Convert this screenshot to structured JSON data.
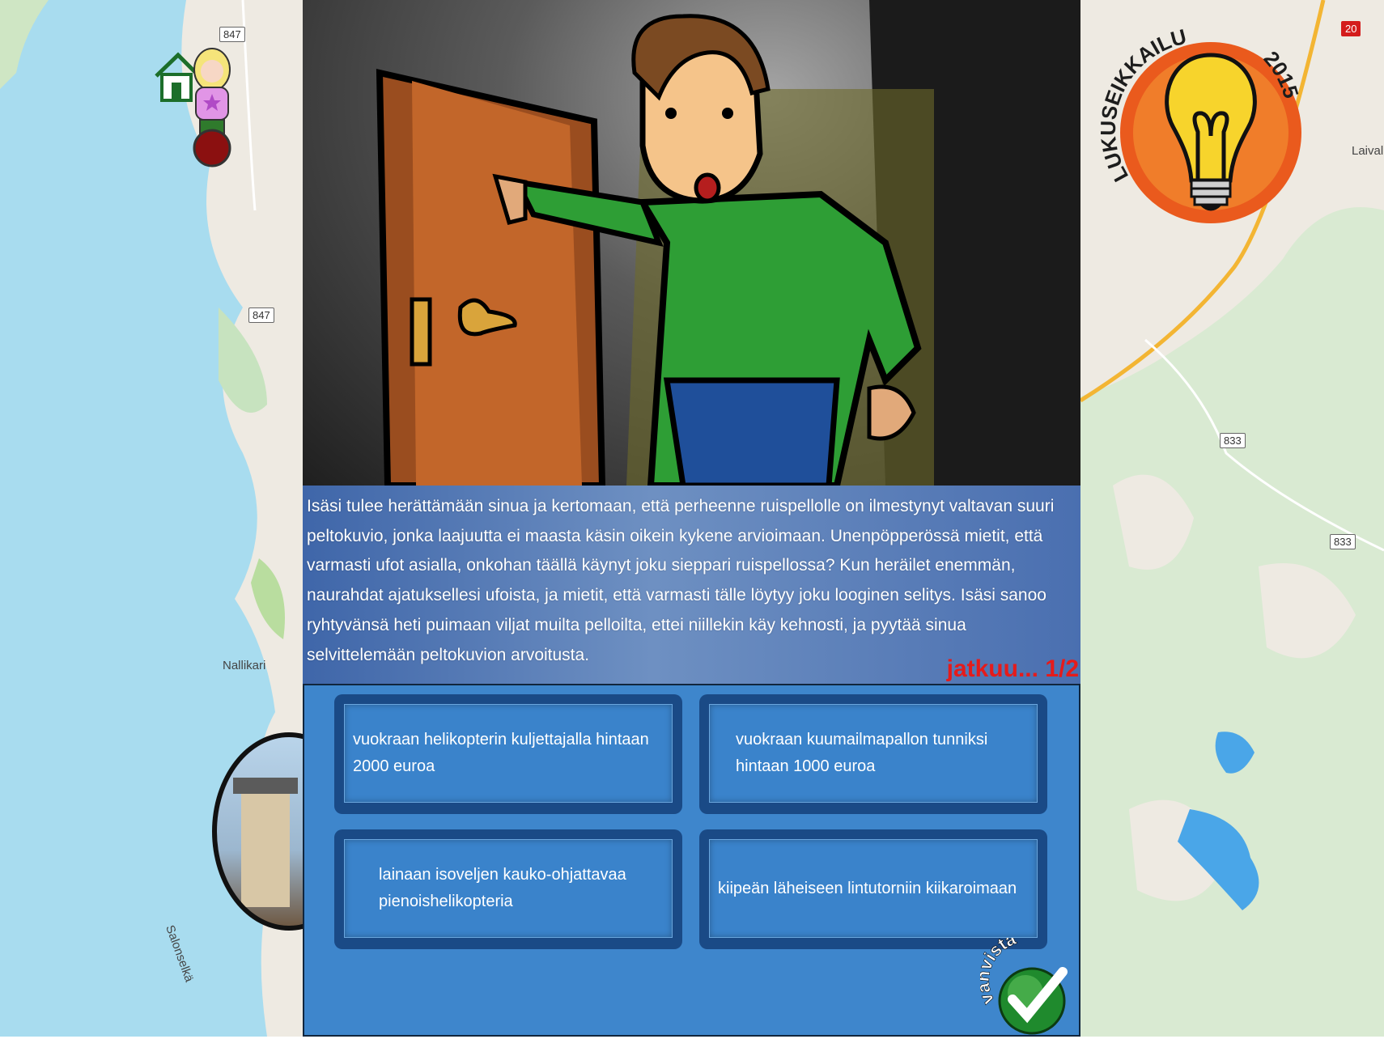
{
  "map": {
    "left_badges": [
      "847",
      "847"
    ],
    "right_badges": [
      "833",
      "833",
      "20"
    ],
    "places": [
      "Nallikari",
      "Salonselkä",
      "Laival"
    ]
  },
  "logo": {
    "text": "LUKUSEIKKAILU",
    "year": "2015",
    "colors": {
      "ring": "#ea5a1d",
      "bulb": "#f7d42c",
      "text": "#1d1d1d"
    }
  },
  "story": {
    "text": "Isäsi tulee herättämään sinua ja kertomaan, että perheenne ruispellolle on ilmestynyt valtavan suuri peltokuvio, jonka laajuutta ei maasta käsin oikein kykene arvioimaan. Unenpöpperössä mietit, että varmasti ufot asialla, onkohan täällä käynyt joku sieppari ruispellossa? Kun heräilet enemmän, naurahdat ajatuksellesi ufoista, ja mietit, että varmasti tälle löytyy joku looginen selitys. Isäsi sanoo ryhtyvänsä heti puimaan viljat muilta pelloilta, ettei niillekin käy kehnosti, ja pyytää sinua selvittelemään peltokuvion arvoitusta.",
    "continue": "jatkuu... 1/2"
  },
  "answers": [
    "vuokraan helikopterin kuljettajalla hintaan 2000 euroa",
    "vuokraan kuumailmapallon tunniksi hintaan 1000 euroa",
    "lainaan isoveljen kauko-ohjattavaa pienoishelikopteria",
    "kiipeän läheiseen lintutorniin kiikaroimaan"
  ],
  "confirm": {
    "label": "vahvista"
  },
  "colors": {
    "panel": "#3e86cc",
    "accent_red": "#e51b1b",
    "button_frame": "#1a4a86"
  }
}
